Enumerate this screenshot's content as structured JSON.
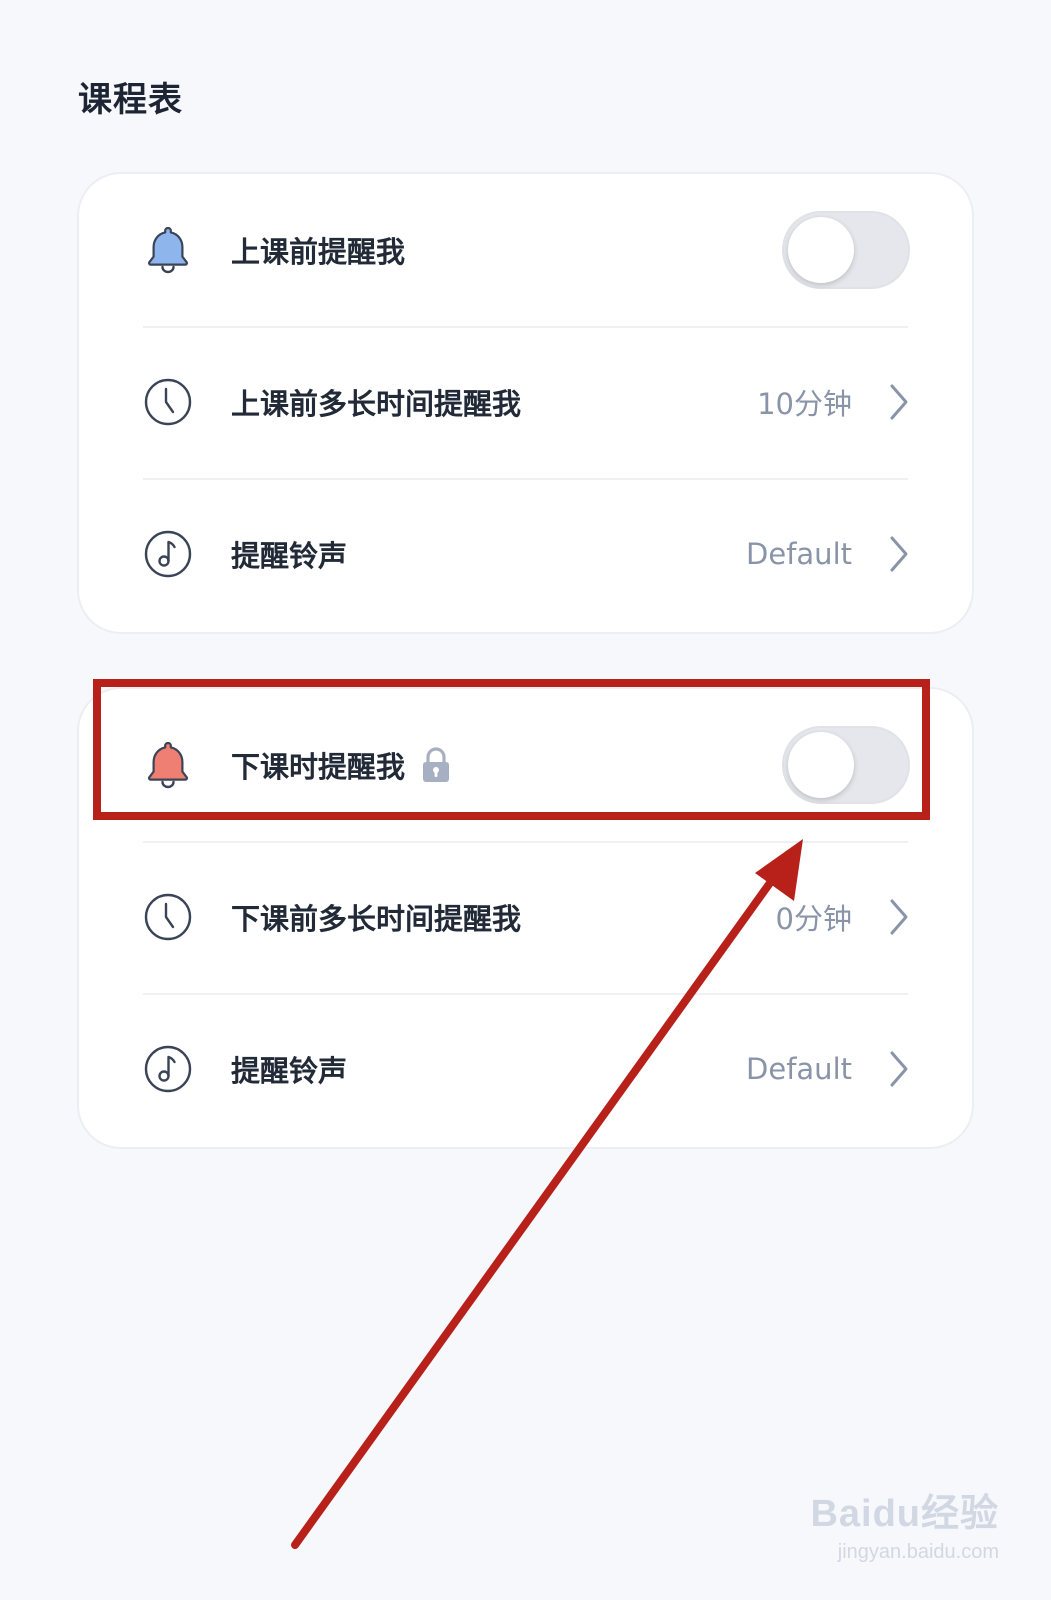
{
  "page": {
    "title": "课程表"
  },
  "before_class": {
    "remind": {
      "label": "上课前提醒我",
      "icon": "bell-icon",
      "toggle_on": false
    },
    "lead_time": {
      "label": "上课前多长时间提醒我",
      "value": "10分钟",
      "icon": "clock-icon"
    },
    "ringtone": {
      "label": "提醒铃声",
      "value": "Default",
      "icon": "music-note-icon"
    }
  },
  "after_class": {
    "remind": {
      "label": "下课时提醒我",
      "icon": "bell-icon",
      "toggle_on": false,
      "locked": true
    },
    "lead_time": {
      "label": "下课前多长时间提醒我",
      "value": "0分钟",
      "icon": "clock-icon"
    },
    "ringtone": {
      "label": "提醒铃声",
      "value": "Default",
      "icon": "music-note-icon"
    }
  },
  "colors": {
    "bell_blue": "#8fb6ec",
    "bell_red": "#ef7f72",
    "annotation_red": "#b8201a",
    "text_primary": "#222a38",
    "text_secondary": "#8a94a8"
  },
  "watermark": {
    "main": "Baidu经验",
    "sub": "jingyan.baidu.com"
  }
}
